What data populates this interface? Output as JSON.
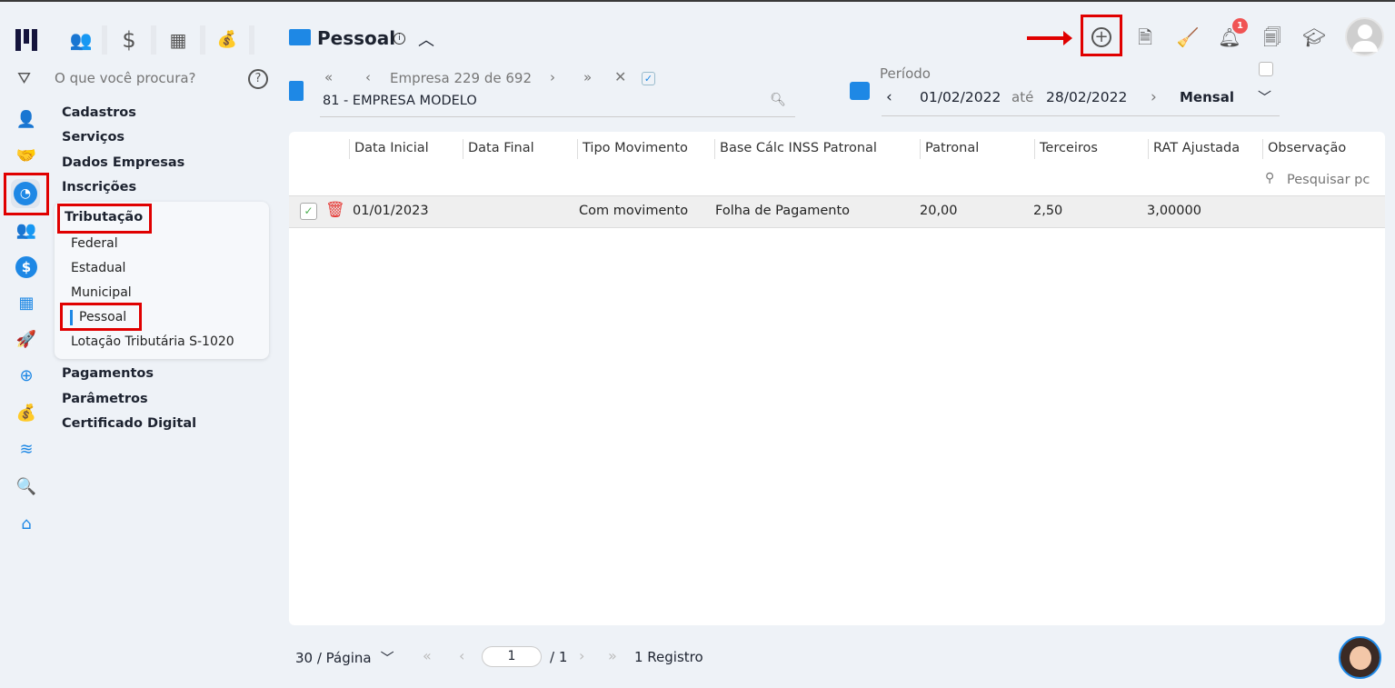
{
  "rail": {
    "icons": [
      "user-gear-icon",
      "handshake-icon",
      "clock-icon",
      "users-icon",
      "dollar-icon",
      "calculator-icon",
      "rocket-icon",
      "network-icon",
      "money-bag-icon",
      "layers-icon",
      "search-icon",
      "home-icon"
    ]
  },
  "topnav": {
    "icons": [
      "users-icon",
      "dollar-icon",
      "calculator-icon",
      "money-bag-icon"
    ]
  },
  "search": {
    "placeholder": "O que você procura?"
  },
  "menu": {
    "items": [
      "Cadastros",
      "Serviços",
      "Dados Empresas",
      "Inscrições",
      "Tributação"
    ],
    "sub": [
      "Federal",
      "Estadual",
      "Municipal",
      "Pessoal",
      "Lotação Tributária S-1020"
    ],
    "after": [
      "Pagamentos",
      "Parâmetros",
      "Certificado Digital"
    ]
  },
  "header": {
    "title": "Pessoal",
    "company_nav": "Empresa 229 de 692",
    "company": "81 - EMPRESA MODELO",
    "period_label": "Período",
    "date_from": "01/02/2022",
    "ate": "até",
    "date_to": "28/02/2022",
    "periodicity": "Mensal",
    "notif_count": "1"
  },
  "table": {
    "columns": [
      "Data Inicial",
      "Data Final",
      "Tipo Movimento",
      "Base Cálc INSS Patronal",
      "Patronal",
      "Terceiros",
      "RAT Ajustada",
      "Observação"
    ],
    "search_placeholder": "Pesquisar pc",
    "rows": [
      [
        "01/01/2023",
        "",
        "Com movimento",
        "Folha de Pagamento",
        "20,00",
        "2,50",
        "3,00000",
        ""
      ]
    ]
  },
  "footer": {
    "per_page": "30 / Página",
    "page": "1",
    "total_pages": "/ 1",
    "records": "1 Registro"
  },
  "colors": {
    "accent": "#1e88e5",
    "highlight": "#e00000"
  }
}
